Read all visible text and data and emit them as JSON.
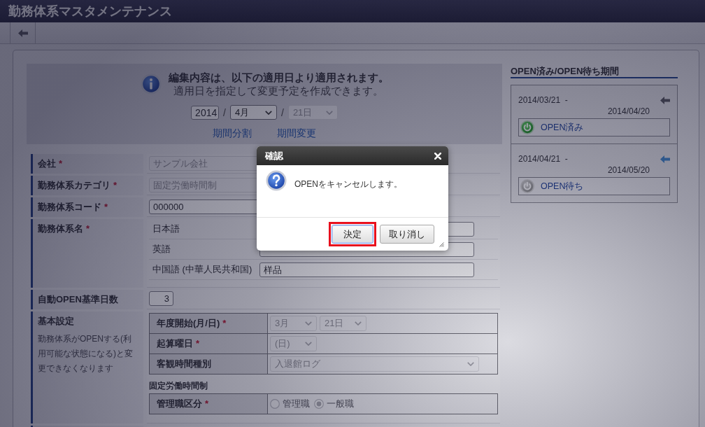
{
  "window": {
    "title": "勤務体系マスタメンテナンス"
  },
  "apply_notice": {
    "heading": "編集内容は、以下の適用日より適用されます。",
    "text": "適用日を指定して変更予定を作成できます。",
    "year": "2014",
    "separators": [
      "/",
      "/"
    ],
    "month": {
      "value": "4月",
      "disabled": false
    },
    "day": {
      "value": "21日",
      "disabled": true
    },
    "links": [
      "期間分割",
      "期間変更"
    ]
  },
  "form": {
    "rows": [
      {
        "kind": "text",
        "label": "会社",
        "required_mark": "*",
        "value": "サンプル会社",
        "disabled": true
      },
      {
        "kind": "text",
        "label": "勤務体系カテゴリ",
        "required_mark": "*",
        "value": "固定労働時間制",
        "disabled": true
      },
      {
        "kind": "text",
        "label": "勤務体系コード",
        "required_mark": "*",
        "value": "000000",
        "disabled": false
      },
      {
        "kind": "names",
        "label": "勤務体系名",
        "required_mark": "*",
        "names": [
          {
            "language": "日本語"
          },
          {
            "language": "英語"
          },
          {
            "language": "中国語 (中華人民共和国)",
            "value": "样品"
          }
        ]
      },
      {
        "kind": "number",
        "label": "自動OPEN基準日数",
        "value": "3"
      },
      {
        "kind": "settings",
        "label": "基本設定",
        "note": "勤務体系がOPENする(利用可能な状態になる)と変更できなくなります",
        "groups": [
          {
            "rows": [
              {
                "kind": "selects",
                "label": "年度開始(月/日)",
                "required_mark": "*",
                "selects": [
                  {
                    "value": "3月",
                    "disabled": true
                  },
                  {
                    "value": "21日",
                    "disabled": true
                  }
                ]
              },
              {
                "kind": "selects",
                "label": "起算曜日",
                "required_mark": "*",
                "selects": [
                  {
                    "value": "(日)",
                    "disabled": true
                  }
                ]
              },
              {
                "kind": "full_select",
                "label": "客観時間種別",
                "selects": [
                  {
                    "value": "入退館ログ",
                    "disabled": true
                  }
                ]
              }
            ]
          },
          {
            "heading": "固定労働時間制",
            "rows": [
              {
                "kind": "radios",
                "label": "管理職区分",
                "required_mark": "*",
                "disabled": true,
                "options": [
                  {
                    "label": "管理職",
                    "selected": false
                  },
                  {
                    "label": "一般職",
                    "selected": true
                  }
                ]
              }
            ]
          }
        ]
      },
      {
        "kind": "blank"
      }
    ]
  },
  "periods": {
    "title": "OPEN済み/OPEN待ち期間",
    "items": [
      {
        "start": "2014/03/21  -",
        "end": "2014/04/20",
        "status": "OPEN済み",
        "kind": "opened",
        "selected": false
      },
      {
        "start": "2014/04/21  -",
        "end": "2014/05/20",
        "status": "OPEN待ち",
        "kind": "waiting",
        "selected": true
      }
    ]
  },
  "dialog": {
    "title": "確認",
    "message": "OPENをキャンセルします。",
    "buttons": [
      {
        "label": "決定",
        "focused": true,
        "highlighted": true
      },
      {
        "label": "取り消し",
        "focused": false,
        "highlighted": false
      }
    ]
  }
}
